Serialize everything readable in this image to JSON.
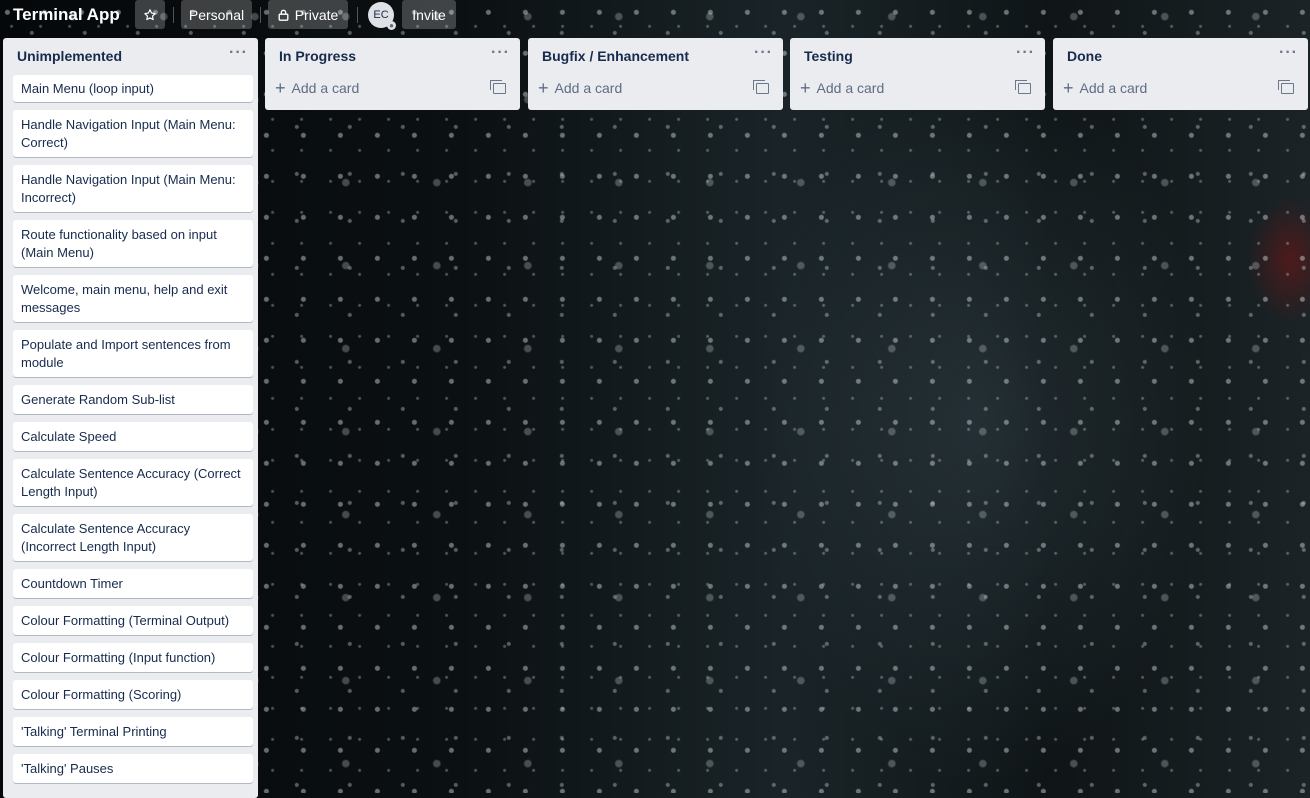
{
  "board": {
    "title": "Terminal App",
    "star_icon": "star-icon",
    "personal_label": "Personal",
    "private_label": "Private",
    "private_icon": "lock-icon",
    "avatar_initials": "EC",
    "invite_label": "Invite"
  },
  "lists": [
    {
      "name": "Unimplemented",
      "cards": [
        "Main Menu (loop input)",
        "Handle Navigation Input (Main Menu: Correct)",
        "Handle Navigation Input (Main Menu: Incorrect)",
        "Route functionality based on input (Main Menu)",
        "Welcome, main menu, help and exit messages",
        "Populate and Import sentences from module",
        "Generate Random Sub-list",
        "Calculate Speed",
        "Calculate Sentence Accuracy (Correct Length Input)",
        "Calculate Sentence Accuracy (Incorrect Length Input)",
        "Countdown Timer",
        "Colour Formatting (Terminal Output)",
        "Colour Formatting (Input function)",
        "Colour Formatting (Scoring)",
        "'Talking' Terminal Printing",
        "'Talking' Pauses"
      ]
    },
    {
      "name": "In Progress",
      "add_card_label": "Add a card"
    },
    {
      "name": "Bugfix / Enhancement",
      "add_card_label": "Add a card"
    },
    {
      "name": "Testing",
      "add_card_label": "Add a card"
    },
    {
      "name": "Done",
      "add_card_label": "Add a card"
    }
  ],
  "list_menu_glyph": "···",
  "add_card_glyph": "+"
}
